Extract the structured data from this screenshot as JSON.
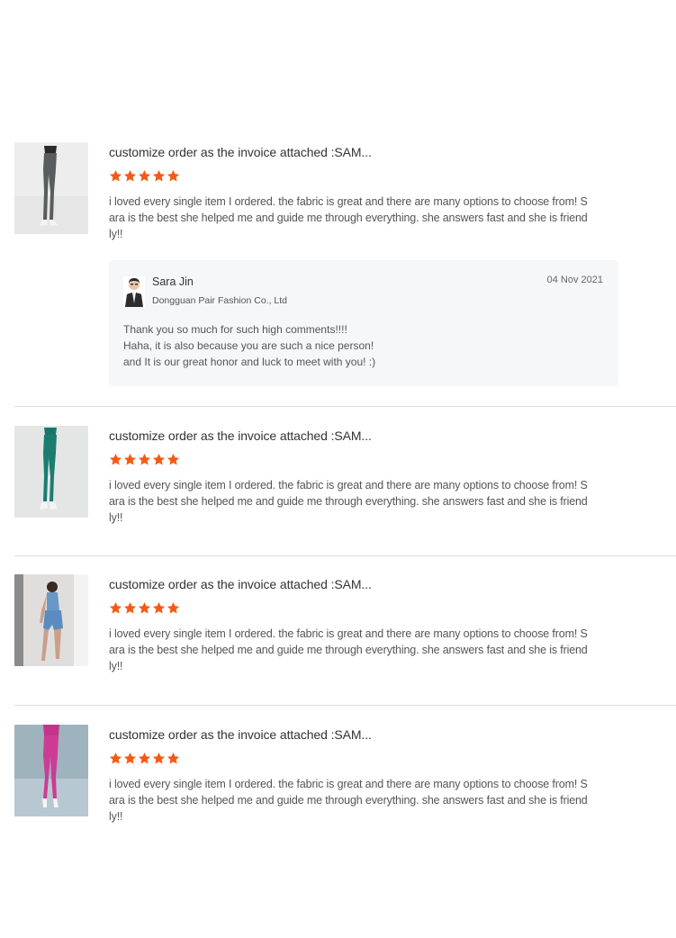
{
  "colors": {
    "star": "#f55a14",
    "divider": "#dcdcdc",
    "reply_background": "#f6f7f9"
  },
  "reviews": [
    {
      "title": "customize order as the invoice attached :SAM...",
      "rating": 5,
      "text": "i loved every single item I ordered. the fabric is great and there are many options to choose from! Sara is the best she helped me and guide me through everything. she answers fast and she is friendly!!",
      "image": "grey-leggings-photo",
      "reply": {
        "name": "Sara Jin",
        "company": "Dongguan Pair Fashion Co., Ltd",
        "date": "04 Nov 2021",
        "text": "Thank you so much for such high comments!!!!\nHaha, it is also because you are such a  nice person!\nand It is our great honor and luck to meet with you! :)"
      }
    },
    {
      "title": "customize order as the invoice attached :SAM...",
      "rating": 5,
      "text": "i loved every single item I ordered. the fabric is great and there are many options to choose from! Sara is the best she helped me and guide me through everything. she answers fast and she is friendly!!",
      "image": "green-leggings-photo"
    },
    {
      "title": "customize order as the invoice attached :SAM...",
      "rating": 5,
      "text": "i loved every single item I ordered. the fabric is great and there are many options to choose from! Sara is the best she helped me and guide me through everything. she answers fast and she is friendly!!",
      "image": "blue-shorts-photo"
    },
    {
      "title": "customize order as the invoice attached :SAM...",
      "rating": 5,
      "text": "i loved every single item I ordered. the fabric is great and there are many options to choose from! Sara is the best she helped me and guide me through everything. she answers fast and she is friendly!!",
      "image": "pink-leggings-photo"
    }
  ]
}
